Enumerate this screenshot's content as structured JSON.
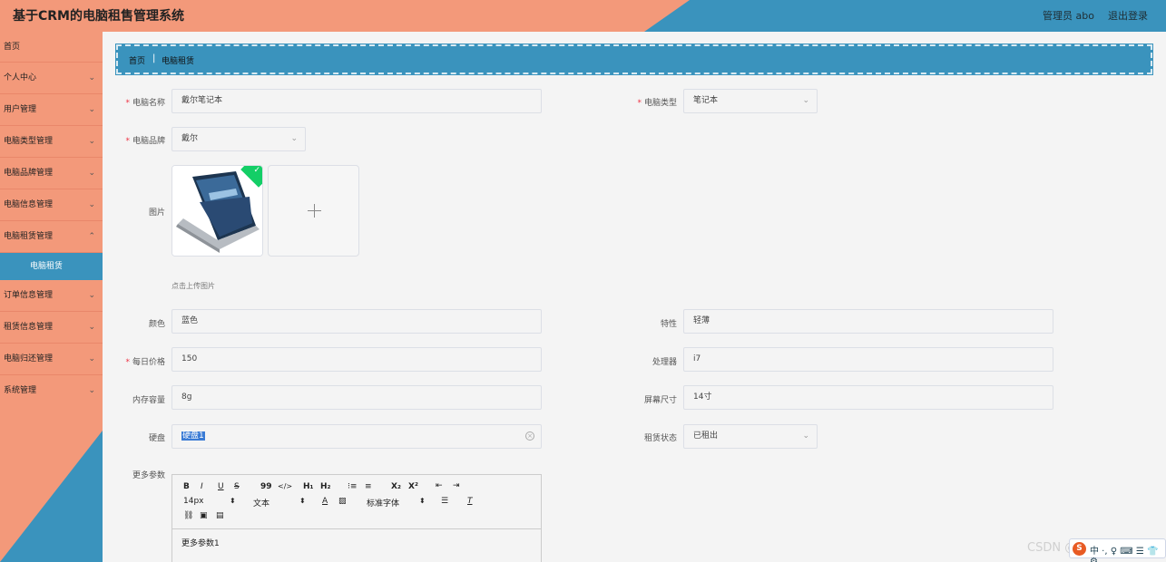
{
  "header": {
    "title": "基于CRM的电脑租售管理系统",
    "user": "管理员 abo",
    "logout": "退出登录"
  },
  "sidebar": {
    "items": [
      {
        "label": "首页"
      },
      {
        "label": "个人中心"
      },
      {
        "label": "用户管理"
      },
      {
        "label": "电脑类型管理"
      },
      {
        "label": "电脑品牌管理"
      },
      {
        "label": "电脑信息管理"
      },
      {
        "label": "电脑租赁管理"
      },
      {
        "label": "订单信息管理"
      },
      {
        "label": "租赁信息管理"
      },
      {
        "label": "电脑归还管理"
      },
      {
        "label": "系统管理"
      }
    ],
    "active_sub": "电脑租赁"
  },
  "breadcrumb": {
    "home": "首页",
    "separator": "|",
    "current": "电脑租赁"
  },
  "form": {
    "name_label": "电脑名称",
    "name_value": "戴尔笔记本",
    "type_label": "电脑类型",
    "type_value": "笔记本",
    "brand_label": "电脑品牌",
    "brand_value": "戴尔",
    "image_label": "图片",
    "upload_tip": "点击上传图片",
    "color_label": "颜色",
    "color_value": "蓝色",
    "feature_label": "特性",
    "feature_value": "轻薄",
    "price_label": "每日价格",
    "price_value": "150",
    "cpu_label": "处理器",
    "cpu_value": "i7",
    "memory_label": "内存容量",
    "memory_value": "8g",
    "screen_label": "屏幕尺寸",
    "screen_value": "14寸",
    "disk_label": "硬盘",
    "disk_value": "硬盘1",
    "status_label": "租赁状态",
    "status_value": "已租出",
    "more_label": "更多参数",
    "required_mark": "*"
  },
  "editor": {
    "toolbar": {
      "bold": "B",
      "italic": "I",
      "underline": "U",
      "strike": "S",
      "quote": "99",
      "code": "</>",
      "h1": "H₁",
      "h2": "H₂",
      "ordered_list": "⁝≡",
      "bullet_list": "≡",
      "subscript": "X₂",
      "superscript": "X²",
      "outdent": "⇤",
      "indent": "⇥",
      "font_size": "14px",
      "text_type": "文本",
      "font_family": "标准字体"
    },
    "content": "更多参数1"
  },
  "watermark": "CSDN @清爽程序",
  "ime": {
    "logo": "S",
    "text": "中 ·, ♀ ⌨ ☰ 👕 ⚙"
  }
}
